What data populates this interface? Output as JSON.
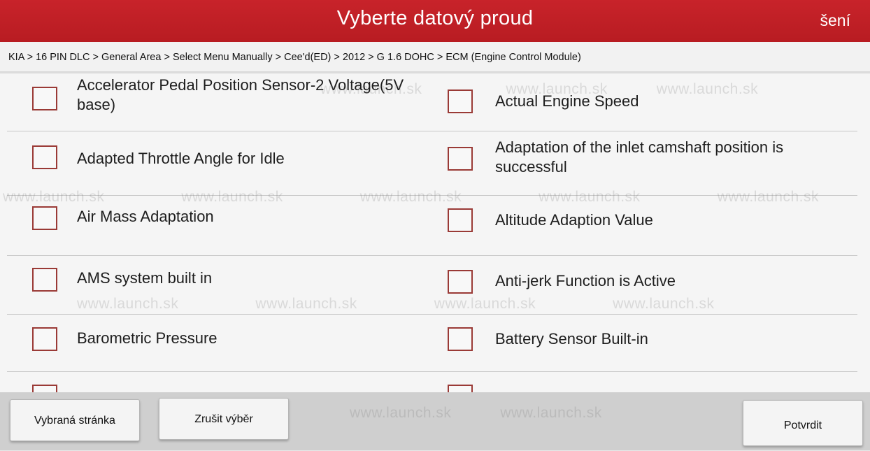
{
  "header": {
    "title": "Vyberte datový proud",
    "right_label": "šení"
  },
  "breadcrumb": "KIA > 16 PIN DLC > General Area > Select Menu Manually > Cee'd(ED) > 2012 > G 1.6 DOHC > ECM (Engine Control Module)",
  "items": {
    "r0_left": "Accelerator Pedal Position Sensor-2 Voltage(5V base)",
    "r0_right": "Actual Engine Speed",
    "r1_left": "Adapted Throttle Angle for Idle",
    "r1_right": "Adaptation of the inlet camshaft position is successful",
    "r2_left": "Air Mass Adaptation",
    "r2_right": "Altitude Adaption Value",
    "r3_left": "AMS system built in",
    "r3_right": "Anti-jerk Function is Active",
    "r4_left": "Barometric Pressure",
    "r4_right": "Battery Sensor Built-in"
  },
  "watermark": {
    "text": "www.launch.sk"
  },
  "footer": {
    "selected_page": "Vybraná stránka",
    "cancel_selection": "Zrušit výběr",
    "confirm": "Potvrdit"
  },
  "colors": {
    "header_red": "#c8232a",
    "checkbox_border": "#9a3a36",
    "background": "#f5f5f5"
  }
}
